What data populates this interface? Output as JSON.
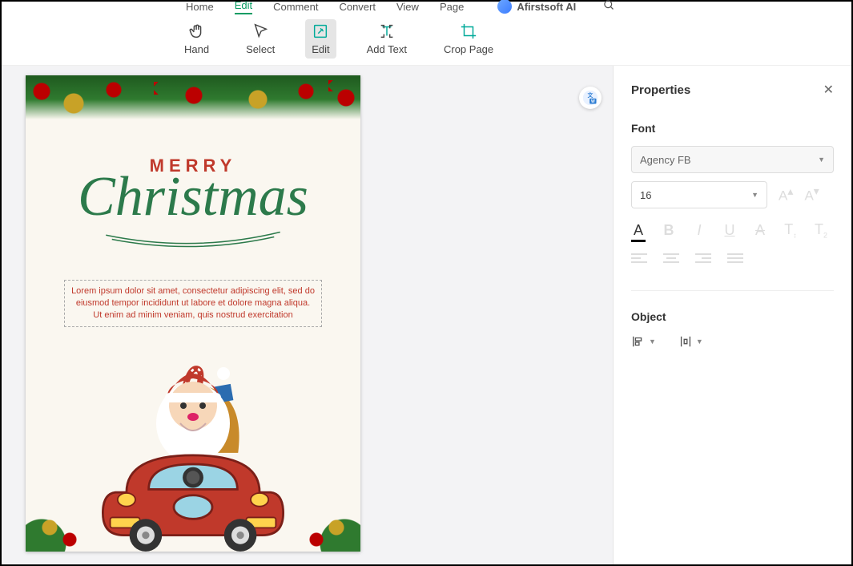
{
  "top_menu": {
    "home": "Home",
    "edit": "Edit",
    "comment": "Comment",
    "convert": "Convert",
    "view": "View",
    "page": "Page",
    "ai": "Afirstsoft AI"
  },
  "toolbar": {
    "hand": "Hand",
    "select": "Select",
    "edit": "Edit",
    "add_text": "Add Text",
    "crop": "Crop Page"
  },
  "document": {
    "merry": "MERRY",
    "christmas": "Christmas",
    "lorem": "Lorem ipsum dolor sit amet, consectetur adipiscing elit, sed do eiusmod tempor incididunt ut labore et dolore magna aliqua. Ut enim ad minim veniam, quis nostrud exercitation"
  },
  "properties": {
    "title": "Properties",
    "font_section": "Font",
    "font_name": "Agency FB",
    "font_size": "16",
    "object_section": "Object"
  }
}
